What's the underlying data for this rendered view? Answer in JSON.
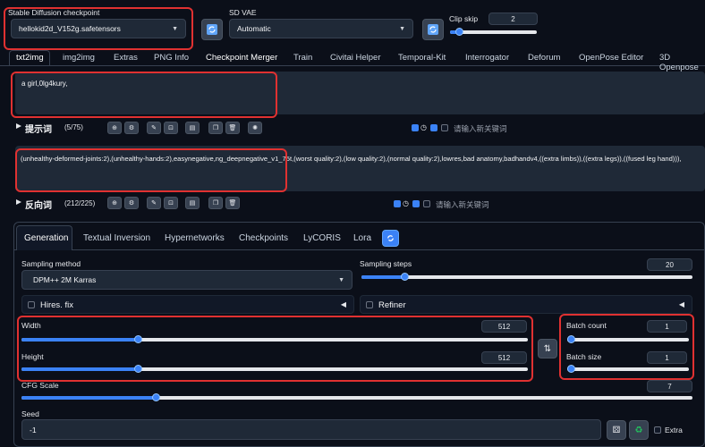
{
  "top": {
    "checkpoint_label": "Stable Diffusion checkpoint",
    "checkpoint_value": "hellokid2d_V152g.safetensors",
    "vae_label": "SD VAE",
    "vae_value": "Automatic",
    "clip_label": "Clip skip",
    "clip_value": "2"
  },
  "tabs": [
    "txt2img",
    "img2img",
    "Extras",
    "PNG Info",
    "Checkpoint Merger",
    "Train",
    "Civitai Helper",
    "Temporal-Kit",
    "Interrogator",
    "Deforum",
    "OpenPose Editor",
    "3D Openpose"
  ],
  "prompt": {
    "text": "a girl,0lg4kury,",
    "title": "提示词",
    "count": "(5/75)",
    "keyword_placeholder": "请输入新关键词"
  },
  "negative": {
    "text": "(unhealthy-deformed-joints:2),(unhealthy-hands:2),easynegative,ng_deepnegative_v1_75t,(worst quality:2),(low quality:2),(normal quality:2),lowres,bad anatomy,badhandv4,((extra limbs)),((extra legs)),((fused leg hand))),",
    "title": "反向词",
    "count": "(212/225)",
    "keyword_placeholder": "请输入新关键词"
  },
  "subtabs": [
    "Generation",
    "Textual Inversion",
    "Hypernetworks",
    "Checkpoints",
    "LyCORIS",
    "Lora"
  ],
  "gen": {
    "sampling_method_label": "Sampling method",
    "sampling_method_value": "DPM++ 2M Karras",
    "sampling_steps_label": "Sampling steps",
    "sampling_steps_value": "20",
    "sampling_steps_fraction": 0.13,
    "hires_label": "Hires. fix",
    "refiner_label": "Refiner",
    "width_label": "Width",
    "width_value": "512",
    "width_fraction": 0.23,
    "height_label": "Height",
    "height_value": "512",
    "height_fraction": 0.23,
    "batch_count_label": "Batch count",
    "batch_count_value": "1",
    "batch_count_fraction": 0.0,
    "batch_size_label": "Batch size",
    "batch_size_value": "1",
    "batch_size_fraction": 0.0,
    "cfg_label": "CFG Scale",
    "cfg_value": "7",
    "cfg_fraction": 0.2,
    "seed_label": "Seed",
    "seed_value": "-1",
    "extra_label": "Extra"
  }
}
